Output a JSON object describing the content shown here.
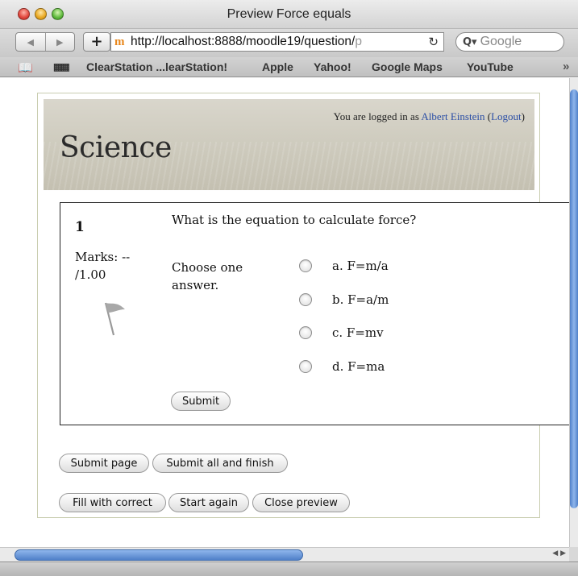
{
  "window": {
    "title": "Preview Force equals"
  },
  "toolbar": {
    "back_icon": "triangle-left",
    "forward_icon": "triangle-right",
    "add_label": "+",
    "url": "http://localhost:8888/moodle19/question/",
    "url_faded": "p",
    "search_placeholder": "Google"
  },
  "bookmarks": {
    "items": [
      "ClearStation ...learStation!",
      "Apple",
      "Yahoo!",
      "Google Maps",
      "YouTube"
    ],
    "more": "»"
  },
  "header": {
    "logged_in_prefix": "You are logged in as ",
    "user_name": "Albert Einstein",
    "logout_label": "Logout",
    "site_title": "Science"
  },
  "question": {
    "number": "1",
    "marks_line1": "Marks: --",
    "marks_line2": "/1.00",
    "text": "What is the equation to calculate force?",
    "choose_line1": "Choose one",
    "choose_line2": "answer.",
    "answers": [
      "a. F=m/a",
      "b. F=a/m",
      "c. F=mv",
      "d. F=ma"
    ],
    "submit_label": "Submit"
  },
  "actions": {
    "submit_page": "Submit page",
    "submit_all": "Submit all and finish",
    "fill_correct": "Fill with correct",
    "start_again": "Start again",
    "close_preview": "Close preview"
  },
  "colors": {
    "link": "#2b4ea6",
    "scroll_thumb": "#4f80c9"
  }
}
